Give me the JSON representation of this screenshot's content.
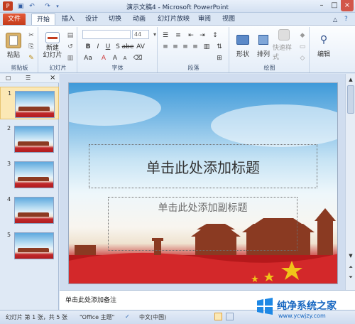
{
  "window": {
    "title": "演示文稿4 - Microsoft PowerPoint"
  },
  "tabs": [
    {
      "label": "文件"
    },
    {
      "label": "开始"
    },
    {
      "label": "插入"
    },
    {
      "label": "设计"
    },
    {
      "label": "切换"
    },
    {
      "label": "动画"
    },
    {
      "label": "幻灯片放映"
    },
    {
      "label": "审阅"
    },
    {
      "label": "视图"
    }
  ],
  "ribbon": {
    "clipboard": {
      "paste": "粘贴",
      "group": "剪贴板"
    },
    "slides": {
      "new_slide": "新建\n幻灯片",
      "group": "幻灯片"
    },
    "font": {
      "size": "44",
      "group": "字体"
    },
    "paragraph": {
      "group": "段落"
    },
    "drawing": {
      "shape": "形状",
      "arrange": "排列",
      "quick_styles": "快速样式",
      "group": "绘图"
    },
    "editing": {
      "edit": "编辑"
    }
  },
  "slides": [
    {
      "number": "1"
    },
    {
      "number": "2"
    },
    {
      "number": "3"
    },
    {
      "number": "4"
    },
    {
      "number": "5"
    }
  ],
  "slide": {
    "title_placeholder": "单击此处添加标题",
    "subtitle_placeholder": "单击此处添加副标题"
  },
  "notes": {
    "placeholder": "单击此处添加备注"
  },
  "status": {
    "slide_info": "幻灯片 第 1 张，共 5 张",
    "theme": "\"Office 主题\"",
    "language": "中文(中国)"
  },
  "watermark": {
    "brand_cn": "纯净系统之家",
    "brand_url": "www.ycwjzy.com"
  },
  "colors": {
    "file_tab": "#c23918",
    "ribbon_bg": "#fdfeff",
    "selected_thumb": "#fbe8b5"
  }
}
